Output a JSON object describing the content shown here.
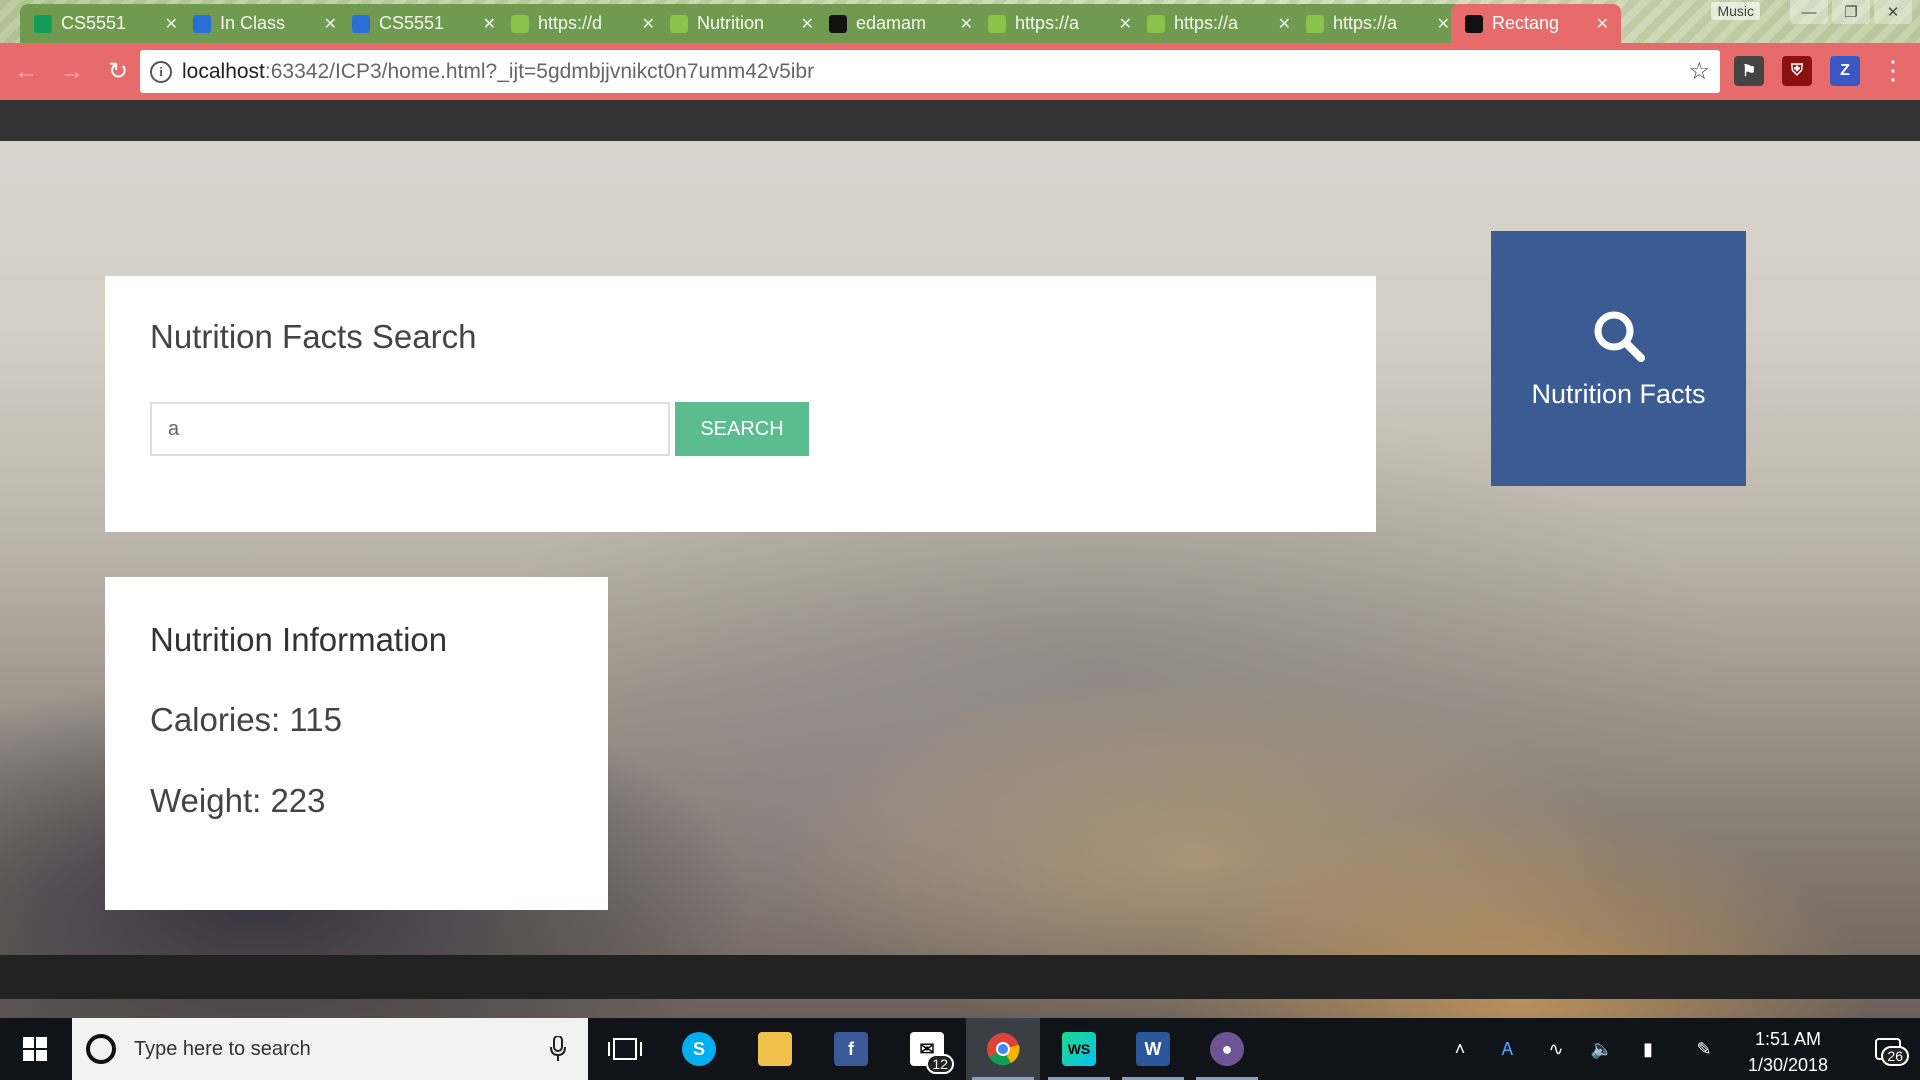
{
  "browser": {
    "tabs": [
      {
        "title": "CS5551",
        "favicon": "sheets-icon",
        "color": "#0f9d58",
        "active": false
      },
      {
        "title": "In Class",
        "favicon": "box-icon",
        "color": "#2a6fd6",
        "active": false
      },
      {
        "title": "CS5551",
        "favicon": "box-icon",
        "color": "#2a6fd6",
        "active": false
      },
      {
        "title": "https://d",
        "favicon": "link-icon",
        "color": "#8bc34a",
        "active": false
      },
      {
        "title": "Nutrition",
        "favicon": "link-icon",
        "color": "#8bc34a",
        "active": false
      },
      {
        "title": "edamam",
        "favicon": "github-icon",
        "color": "#111111",
        "active": false
      },
      {
        "title": "https://a",
        "favicon": "link-icon",
        "color": "#8bc34a",
        "active": false
      },
      {
        "title": "https://a",
        "favicon": "link-icon",
        "color": "#8bc34a",
        "active": false
      },
      {
        "title": "https://a",
        "favicon": "link-icon",
        "color": "#8bc34a",
        "active": false
      },
      {
        "title": "Rectang",
        "favicon": "webstorm-icon",
        "color": "#111111",
        "active": true
      }
    ],
    "music_label": "Music",
    "url_host": "localhost",
    "url_rest": ":63342/ICP3/home.html?_ijt=5gdmbjjvnikct0n7umm42v5ibr"
  },
  "search_card": {
    "title": "Nutrition Facts Search",
    "input_value": "a",
    "button_label": "SEARCH"
  },
  "info_card": {
    "title": "Nutrition Information",
    "calories": "Calories: 115",
    "weight": "Weight: 223"
  },
  "tile": {
    "label": "Nutrition Facts",
    "icon": "search-icon"
  },
  "taskbar": {
    "search_placeholder": "Type here to search",
    "mail_badge": "12",
    "time": "1:51 AM",
    "date": "1/30/2018",
    "notification_count": "26"
  },
  "colors": {
    "browser_accent": "#e76b6b",
    "search_button": "#5bbd8f",
    "tile": "#3b5b93"
  }
}
